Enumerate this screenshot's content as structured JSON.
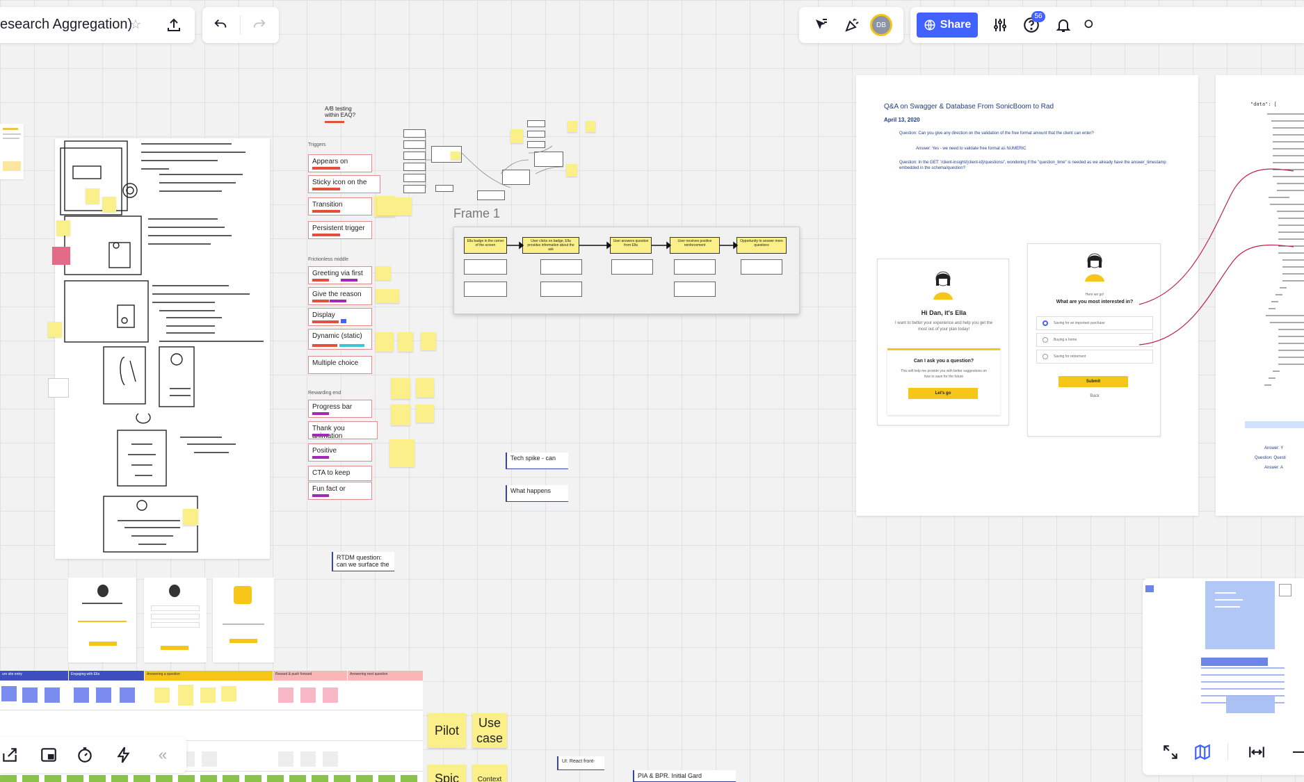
{
  "board_title": "esearch Aggregation)",
  "toolbar_right": {
    "avatar_initials": "DB",
    "share_label": "Share",
    "help_badge": "56"
  },
  "notes": {
    "ab_testing": "A/B testing within EAQ?",
    "triggers_title": "Triggers",
    "triggers": [
      "Appears on",
      "Sticky icon on the",
      "Transition",
      "Persistent trigger"
    ],
    "frictionless_title": "Frictionless middle",
    "frictionless": [
      "Greeting via first",
      "Give the reason",
      "Display",
      "Dynamic (static)",
      "Multiple choice"
    ],
    "rewarding_title": "Rewarding end",
    "rewarding": [
      "Progress bar",
      "Thank you animation",
      "Positive",
      "CTA to keep",
      "Fun fact or"
    ],
    "frame_title": "Frame 1",
    "flow_steps": [
      "Ella badge in the corner of the screen",
      "User clicks on badge, Ella provides information about the ask",
      "User answers question from Ella",
      "User receives positive reinforcement",
      "Opportunity to answer more questions"
    ],
    "tech_spike": "Tech spike - can",
    "what_happens": "What happens",
    "rtdm": "RTDM question: can we surface the",
    "ui_react": "UI: React front-",
    "pia_bpr": "PIA & BPR. Initial Gard",
    "pilot": "Pilot",
    "use_case": "Use case",
    "spike": "Spic",
    "context": "Context"
  },
  "doc": {
    "title": "Q&A on Swagger & Database From SonicBoom to Rad",
    "date": "April 13, 2020",
    "q1": "Question: Can you give any direction on the validation of the free format amount that the client can enter?",
    "a1": "Answer: Yes - we need to validate free format as NUMERIC",
    "q2": "Question: In the GET: '/client-insight/{client-id}/questions/', wondering if the \"question_time\" is needed as we already have the answer_timestamp embedded in the schema/question?"
  },
  "mockups": {
    "greet_title": "Hi Dan, it's Ella",
    "greet_body": "I want to better your experience and help you get the most out of your plan today!",
    "ask_title": "Can I ask you a question?",
    "ask_body": "This will help me provide you with better suggestions on how to save for the future",
    "ask_button": "Let's go",
    "here_we_go": "Here we go!",
    "interest_q": "What are you most interested in?",
    "options": [
      "Saving for an important purchase",
      "Buying a home",
      "Saving for retirement"
    ],
    "submit": "Submit",
    "back": "Back"
  },
  "code": {
    "data_label": "\"data\": [",
    "answer_y": "Answer: Y",
    "question_q": "Question: Questi",
    "answer_a": "Answer: A"
  },
  "journey": {
    "columns": [
      "ure site entry",
      "Engaging with Ella",
      "Answering a question",
      "Reward & push forward",
      "Answering next question"
    ]
  },
  "colors": {
    "accent": "#4262ff",
    "sticky": "#fbef8a",
    "red_bar": "#e0503a",
    "purple_bar": "#a22ab2",
    "teal_bar": "#3bc4d4"
  }
}
